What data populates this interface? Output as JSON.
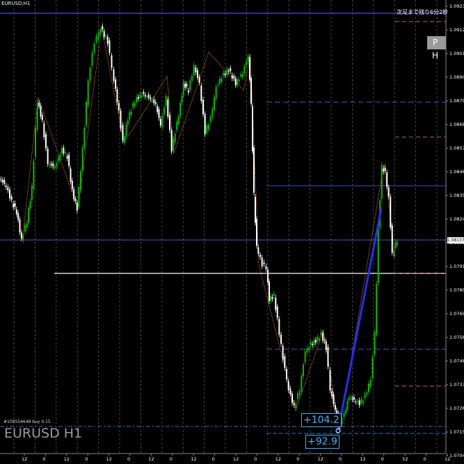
{
  "window": {
    "symbol_title": "EURUSD,H1",
    "watermark": "EURUSD H1"
  },
  "remaining_time": "次足まで残り6分2秒",
  "ph_button": "P H",
  "price_tag": "1.08137",
  "order_label": "#109554648 buy 0.15",
  "pips": {
    "first": "+104.2",
    "second": "+92.9"
  },
  "price_axis": {
    "labels": [
      "1.09235",
      "1.09125",
      "1.09015",
      "1.08905",
      "1.08795",
      "1.08685",
      "1.08575",
      "1.08465",
      "1.08355",
      "1.08245",
      "1.08025",
      "1.07915",
      "1.07805",
      "1.07695",
      "1.07585",
      "1.07480",
      "1.07370",
      "1.07260",
      "1.07150",
      "1.07040"
    ]
  },
  "time_axis": {
    "labels": [
      "12",
      "0",
      "12",
      "0",
      "12",
      "0",
      "12",
      "0",
      "12",
      "0",
      "12",
      "0",
      "12",
      "0",
      "12",
      "0",
      "12",
      "0",
      "12",
      "0",
      "12"
    ]
  },
  "colors": {
    "bull": "#00c000",
    "bear": "#ffffff",
    "zigzag": "#c06000",
    "trend": "#2030ff",
    "grid": "#555555"
  }
}
